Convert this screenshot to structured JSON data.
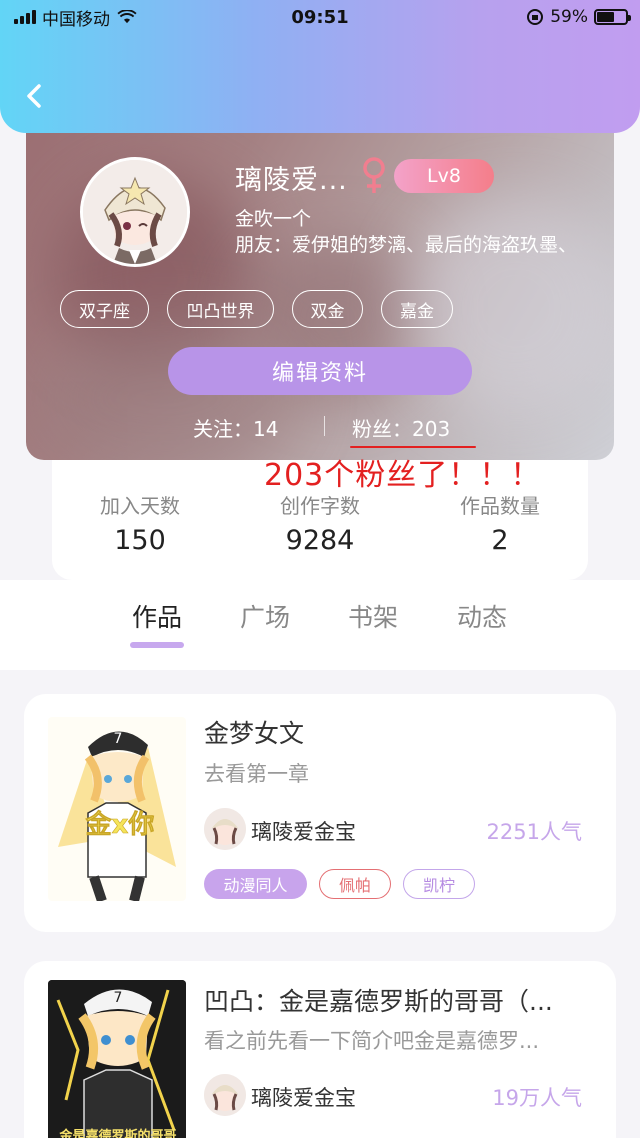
{
  "status_bar": {
    "carrier": "中国移动",
    "time": "09:51",
    "battery": "59%",
    "battery_level": 0.59,
    "icons": [
      "signal-icon",
      "wifi-icon",
      "orientation-lock-icon",
      "battery-icon"
    ]
  },
  "colors": {
    "header_gradient_start": "#62d5f6",
    "header_gradient_end": "#c19df0",
    "accent_purple": "#b894e8",
    "annotation_red": "#e32020"
  },
  "profile": {
    "name": "璃陵爱...",
    "gender_icon": "female-icon",
    "level": "Lv8",
    "bio_line1": "金吹一个",
    "bio_line2": "朋友：爱伊姐的梦漓、最后的海盗玖墨、",
    "tags": [
      "双子座",
      "凹凸世界",
      "双金",
      "嘉金"
    ],
    "edit_label": "编辑资料",
    "following": "关注：14",
    "fans": "粉丝：203"
  },
  "annotation": "203个粉丝了！！！",
  "stats": [
    {
      "label": "加入天数",
      "value": "150"
    },
    {
      "label": "创作字数",
      "value": "9284"
    },
    {
      "label": "作品数量",
      "value": "2"
    }
  ],
  "tabs": [
    "作品",
    "广场",
    "书架",
    "动态"
  ],
  "works": [
    {
      "title": "金梦女文",
      "desc": "去看第一章",
      "author": "璃陵爱金宝",
      "popularity": "2251人气",
      "cover_text": "金x你",
      "tags": [
        "动漫同人",
        "佩帕",
        "凯柠"
      ]
    },
    {
      "title": "凹凸：金是嘉德罗斯的哥哥（...",
      "desc": "看之前先看一下简介吧金是嘉德罗...",
      "author": "璃陵爱金宝",
      "popularity": "19万人气",
      "cover_text": "金是嘉德罗斯的哥哥",
      "tags": []
    }
  ]
}
